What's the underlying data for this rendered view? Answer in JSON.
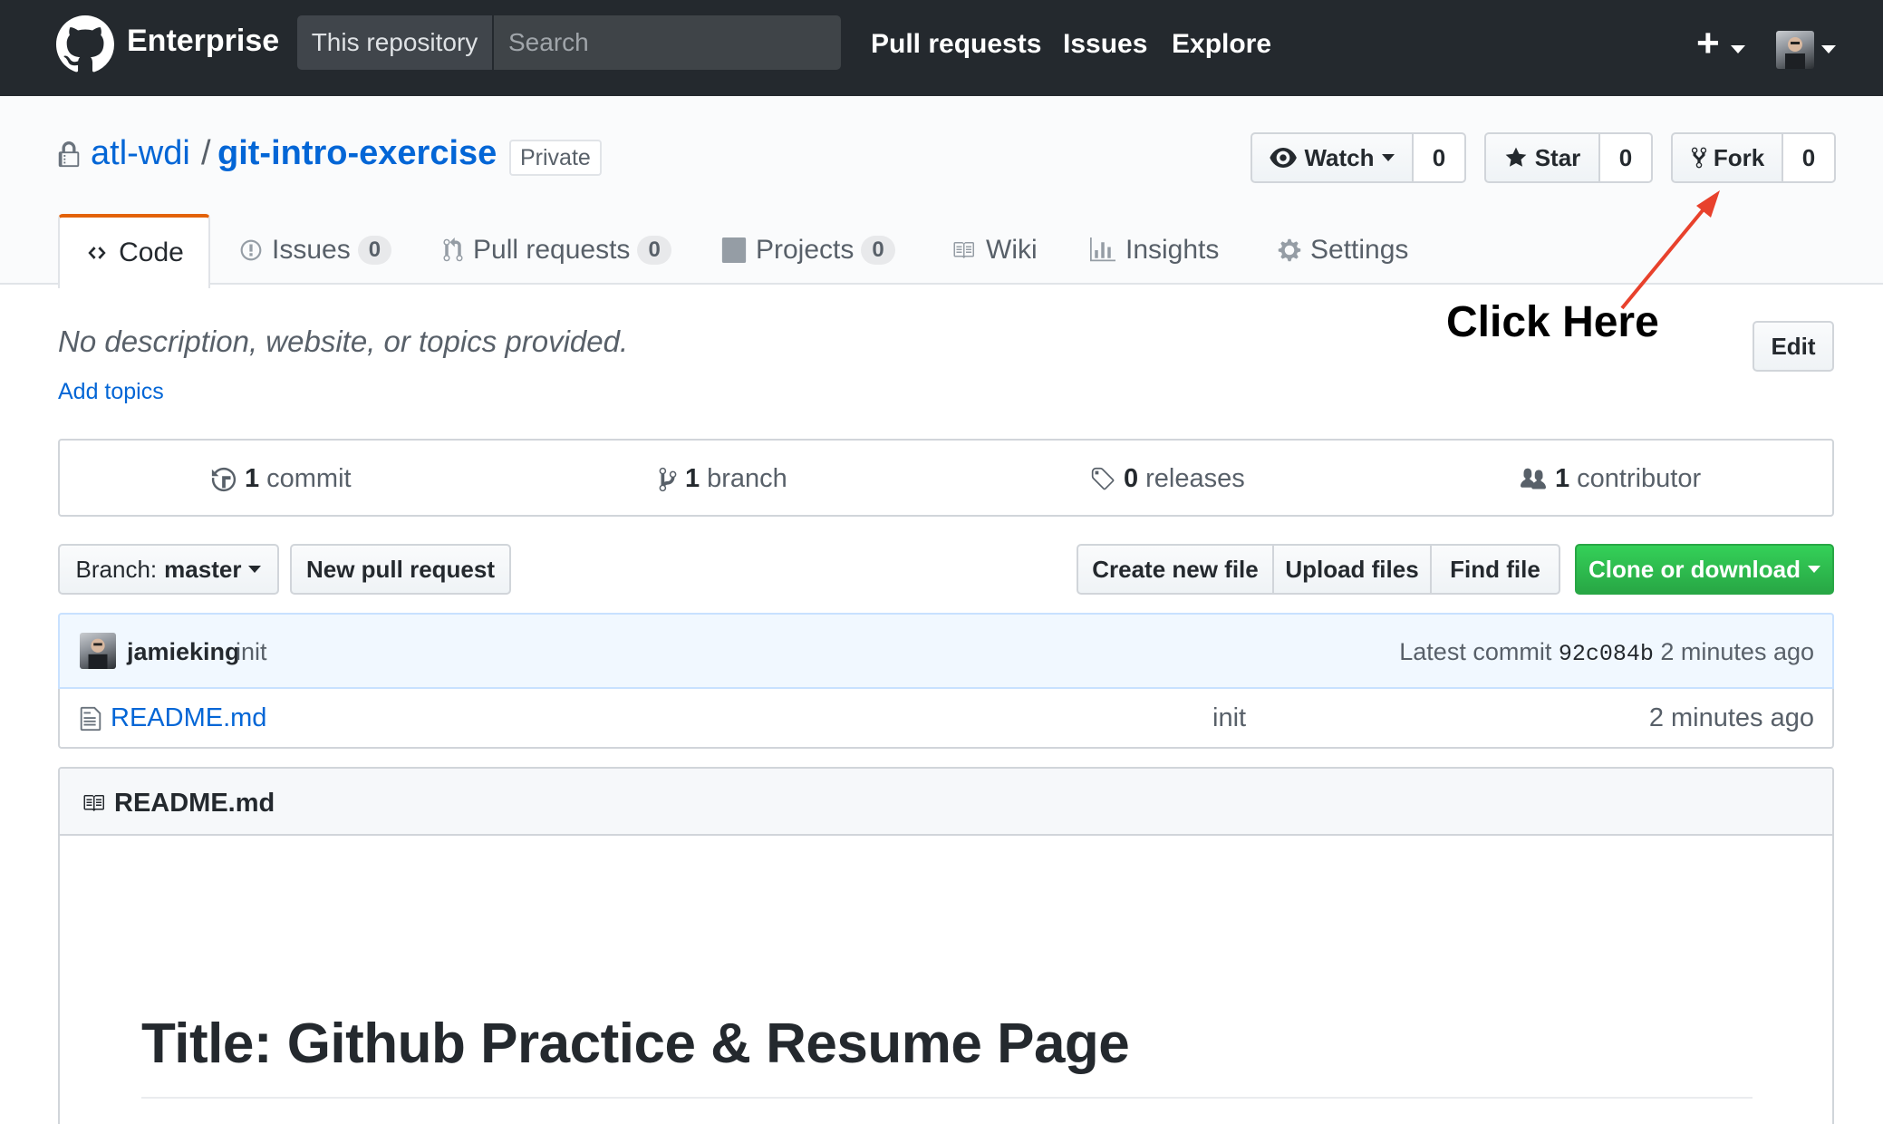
{
  "header": {
    "brand": "Enterprise",
    "scope_label": "This repository",
    "search_placeholder": "Search",
    "nav": [
      "Pull requests",
      "Issues",
      "Explore"
    ],
    "plus": "+"
  },
  "repo": {
    "owner": "atl-wdi",
    "separator": "/",
    "name": "git-intro-exercise",
    "visibility": "Private",
    "watch": {
      "label": "Watch",
      "count": "0"
    },
    "star": {
      "label": "Star",
      "count": "0"
    },
    "fork": {
      "label": "Fork",
      "count": "0"
    },
    "tabs": [
      {
        "label": "Code",
        "icon": "code-icon"
      },
      {
        "label": "Issues",
        "count": "0",
        "icon": "issue-icon"
      },
      {
        "label": "Pull requests",
        "count": "0",
        "icon": "pull-request-icon"
      },
      {
        "label": "Projects",
        "count": "0",
        "icon": "project-icon"
      },
      {
        "label": "Wiki",
        "icon": "book-icon"
      },
      {
        "label": "Insights",
        "icon": "graph-icon"
      },
      {
        "label": "Settings",
        "icon": "gear-icon"
      }
    ]
  },
  "about": {
    "description": "No description, website, or topics provided.",
    "add_topics": "Add topics",
    "edit": "Edit"
  },
  "annotation": {
    "text": "Click Here",
    "color": "#e8412c"
  },
  "summary": {
    "commits": {
      "num": "1",
      "label": "commit"
    },
    "branches": {
      "num": "1",
      "label": "branch"
    },
    "releases": {
      "num": "0",
      "label": "releases"
    },
    "contributors": {
      "num": "1",
      "label": "contributor"
    }
  },
  "toolbar": {
    "branch_prefix": "Branch:",
    "branch_name": "master",
    "new_pr": "New pull request",
    "create_file": "Create new file",
    "upload_files": "Upload files",
    "find_file": "Find file",
    "clone": "Clone or download"
  },
  "latest_commit": {
    "author": "jamieking",
    "message": "init",
    "prefix": "Latest commit",
    "sha": "92c084b",
    "age": "2 minutes ago"
  },
  "files": [
    {
      "name": "README.md",
      "message": "init",
      "age": "2 minutes ago"
    }
  ],
  "readme": {
    "filename": "README.md",
    "heading": "Title: Github Practice & Resume Page"
  },
  "colors": {
    "header_bg": "#24292e",
    "link": "#0366d6",
    "tab_accent": "#e36209",
    "clone_green": "#28a745"
  }
}
